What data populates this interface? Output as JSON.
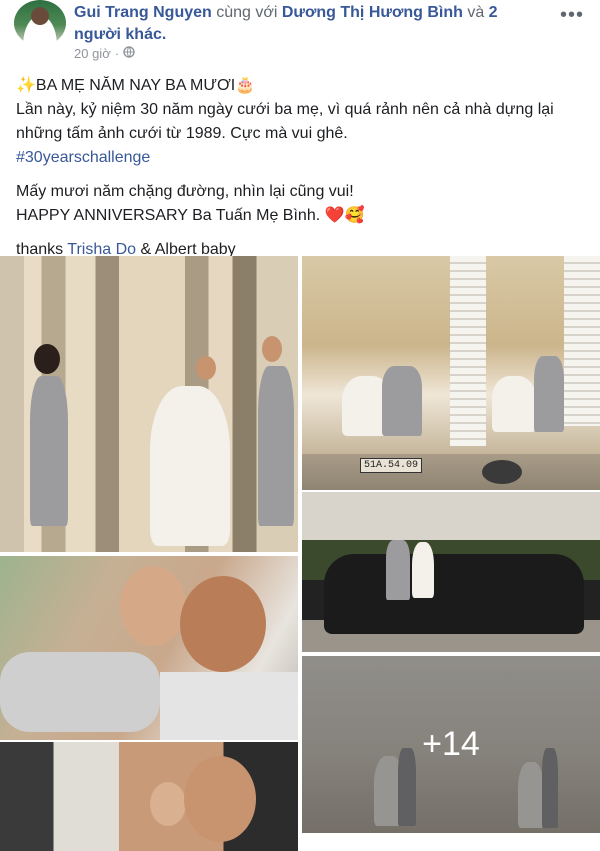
{
  "post": {
    "author": "Gui Trang Nguyen",
    "with_text": " cùng với ",
    "tagged_person": "Dương Thị Hương Bình",
    "and_text": " và ",
    "others": "2 người khác.",
    "time": "20 giờ",
    "dot": "·",
    "privacy_icon": "globe-icon",
    "more_label": "•••",
    "title_line": "✨BA MẸ NĂM NAY BA MƯƠI🎂",
    "line2": "Lần này, kỷ niệm 30 năm ngày cưới ba mẹ, vì quá rảnh nên cả nhà dựng lại những tấm ảnh cưới từ 1989. Cực mà vui ghê.",
    "hashtag": "#30yearschallenge",
    "line4": "Mấy mươi năm chặng đường, nhìn lại cũng vui!",
    "line5": "HAPPY ANNIVERSARY Ba Tuấn Mẹ Bình. ❤️🥰",
    "thanks_prefix": "thanks ",
    "thanks_mention": "Trisha Do",
    "thanks_suffix": " & Albert baby"
  },
  "photos": {
    "plate_text": "51A.54.09",
    "more_count": "+14"
  },
  "colors": {
    "link": "#385898",
    "text": "#1c1e21",
    "meta": "#90949c"
  }
}
